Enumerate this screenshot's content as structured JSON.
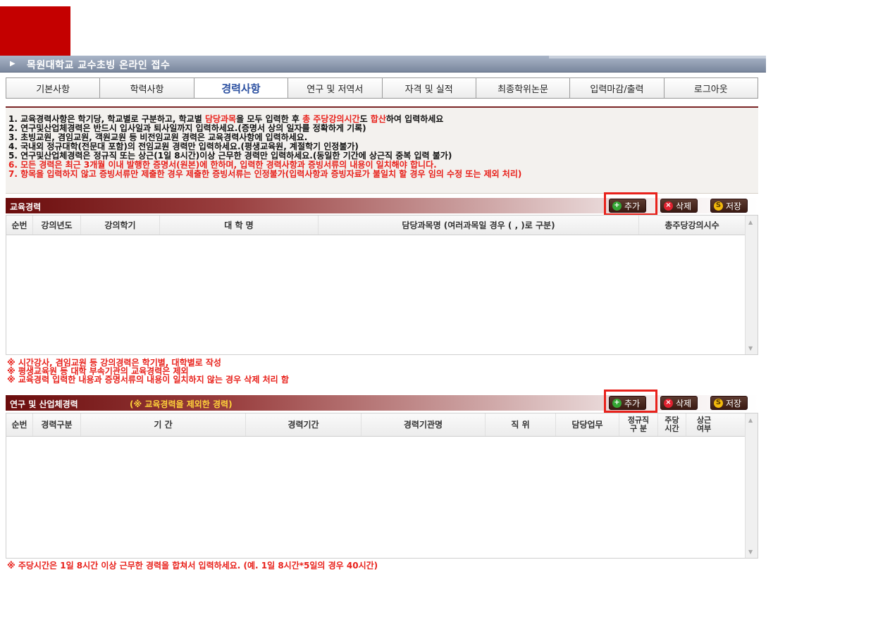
{
  "header": {
    "title": "목원대학교 교수초빙 온라인 접수",
    "arrow_icon": "triangle-right-icon",
    "logo_color": "#c40000"
  },
  "nav": {
    "tabs": [
      {
        "label": "기본사항",
        "active": false
      },
      {
        "label": "학력사항",
        "active": false
      },
      {
        "label": "경력사항",
        "active": true
      },
      {
        "label": "연구 및 저역서",
        "active": false
      },
      {
        "label": "자격 및 실적",
        "active": false
      },
      {
        "label": "최종학위논문",
        "active": false
      },
      {
        "label": "입력마감/출력",
        "active": false
      },
      {
        "label": "로그아웃",
        "active": false
      }
    ]
  },
  "notice": {
    "line1_parts": [
      "1. 교육경력사항은 학기당, 학교별로 구분하고, 학교별 ",
      "담당과목",
      "을 모두 입력한 후 ",
      "총 주당강의시간",
      "도 ",
      "합산",
      "하여 입력하세요"
    ],
    "line2": "2. 연구및산업체경력은 반드시 입사일과 퇴사일까지 입력하세요.(증명서 상의 일자를 정확하게 기록)",
    "line3": "3. 초빙교원, 겸임교원, 객원교원 등 비전임교원 경력은 교육경력사항에 입력하세요.",
    "line4": "4. 국내외 정규대학(전문대 포함)의 전임교원 경력만 입력하세요.(평생교육원, 계절학기 인정불가)",
    "line5": "5. 연구및산업체경력은 정규직 또는 상근(1일 8시간)이상 근무한 경력만 입력하세요.(동일한 기간에 상근직 중복 입력 불가)",
    "line6": "6. 모든 경력은 최근 3개월 이내 발행한 증명서(원본)에 한하며, 입력한 경력사항과 증빙서류의 내용이 일치해야 합니다.",
    "line7": "7. 항목을 입력하지 않고 증빙서류만 제출한 경우 제출한 증빙서류는 인정불가(입력사항과 증빙자료가 불일치 할 경우 임의 수정 또는 제외 처리)"
  },
  "buttons": {
    "add": "추가",
    "delete": "삭제",
    "save": "저장",
    "add_icon": "plus-circle-icon",
    "delete_icon": "x-circle-icon",
    "save_icon": "s-circle-icon"
  },
  "education": {
    "title": "교육경력",
    "columns": [
      "순번",
      "강의년도",
      "강의학기",
      "대 학 명",
      "담당과목명 (여러과목일 경우 ( , )로 구분)",
      "총주당강의시수"
    ],
    "notes": [
      "※ 시간강사, 겸임교원 등 강의경력은 학기별, 대학별로 작성",
      "※ 평생교육원 등 대학 부속기관의 교육경력은 제외",
      "※ 교육경력 입력한 내용과 증명서류의 내용이 일치하지 않는 경우 삭제 처리 함"
    ]
  },
  "research": {
    "title": "연구 및 산업체경력",
    "subtitle": "(※ 교육경력을 제외한 경력)",
    "columns": [
      "순번",
      "경력구분",
      "기 간",
      "경력기간",
      "경력기관명",
      "직 위",
      "담당업무",
      "정규직\n구 분",
      "주당\n시간",
      "상근\n여부"
    ],
    "note": "※ 주당시간은 1일 8시간 이상 근무한 경력을 합쳐서 입력하세요. (예. 1일 8시간*5일의 경우 40시간)"
  },
  "colors": {
    "accent_red": "#e8211b",
    "section_dark": "#6b0d0d",
    "active_tab": "#2a4fa0"
  }
}
